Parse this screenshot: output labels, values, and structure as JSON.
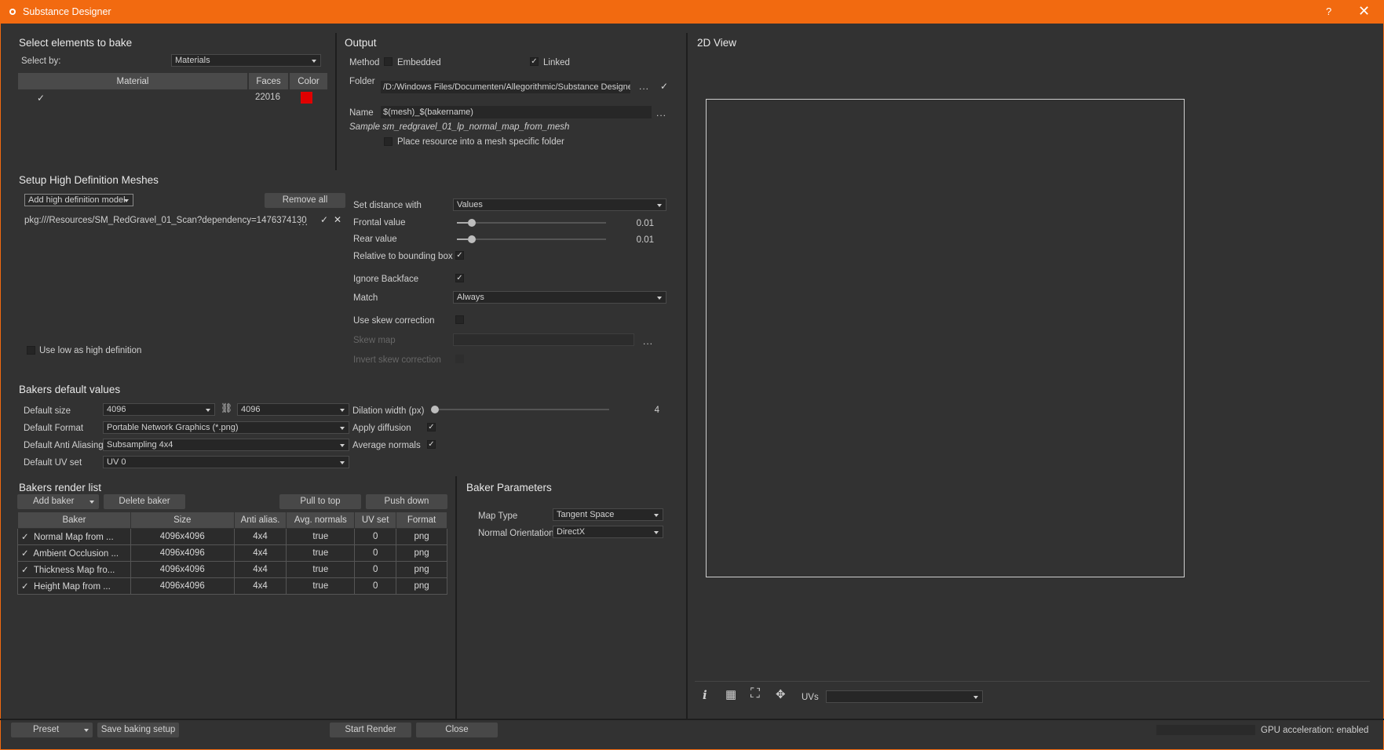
{
  "window": {
    "title": "Substance Designer",
    "help": "?",
    "close": "✕"
  },
  "select": {
    "heading": "Select elements to bake",
    "select_by_label": "Select by:",
    "select_by_value": "Materials",
    "columns": [
      "Material",
      "Faces",
      "Color"
    ],
    "rows": [
      {
        "checked": true,
        "material": "",
        "faces": "22016",
        "color": "#e00000"
      }
    ]
  },
  "output": {
    "heading": "Output",
    "method_label": "Method",
    "embedded_label": "Embedded",
    "embedded": false,
    "linked_label": "Linked",
    "linked": true,
    "folder_label": "Folder",
    "folder_value": "/D:/Windows Files/Documenten/Allegorithmic/Substance Designer",
    "folder_dots": "...",
    "name_label": "Name",
    "name_value": "$(mesh)_$(bakername)",
    "name_dots": "...",
    "sample_label": "Sample",
    "sample_value": "sm_redgravel_01_lp_normal_map_from_mesh",
    "specific_folder_label": "Place resource into a mesh specific folder",
    "specific_folder": false
  },
  "highdef": {
    "heading": "Setup High Definition Meshes",
    "add_label": "Add high definition model",
    "remove_all_label": "Remove all",
    "mesh_path": "pkg:///Resources/SM_RedGravel_01_Scan?dependency=1476374130",
    "mesh_dots": "...",
    "use_low_label": "Use low as high definition",
    "use_low": false
  },
  "distance": {
    "set_distance_label": "Set distance with",
    "set_distance_value": "Values",
    "frontal_label": "Frontal value",
    "frontal_value": "0.01",
    "frontal_level": 0.04,
    "rear_label": "Rear value",
    "rear_value": "0.01",
    "rear_level": 0.04,
    "relative_label": "Relative to bounding box",
    "relative": true,
    "ignore_backface_label": "Ignore Backface",
    "ignore_backface": true,
    "match_label": "Match",
    "match_value": "Always",
    "skew_correction_label": "Use skew correction",
    "skew_correction": false,
    "skew_map_label": "Skew map",
    "skew_map_dots": "...",
    "invert_skew_label": "Invert skew correction"
  },
  "defaults": {
    "heading": "Bakers default values",
    "size_label": "Default size",
    "size_w": "4096",
    "size_h": "4096",
    "format_label": "Default Format",
    "format_value": "Portable Network Graphics (*.png)",
    "aa_label": "Default Anti Aliasing",
    "aa_value": "Subsampling 4x4",
    "uv_label": "Default UV set",
    "uv_value": "UV 0",
    "dilation_label": "Dilation width (px)",
    "dilation_value": "4",
    "dilation_level": 0.0,
    "diffusion_label": "Apply diffusion",
    "diffusion": true,
    "avg_normals_label": "Average normals",
    "avg_normals": true
  },
  "render_list": {
    "heading": "Bakers render list",
    "add_baker_label": "Add baker",
    "delete_baker_label": "Delete baker",
    "pull_top_label": "Pull to top",
    "push_down_label": "Push down",
    "columns": [
      "Baker",
      "Size",
      "Anti alias.",
      "Avg. normals",
      "UV set",
      "Format"
    ],
    "rows": [
      {
        "checked": true,
        "baker": "Normal Map from ...",
        "size": "4096x4096",
        "aa": "4x4",
        "avg": "true",
        "uv": "0",
        "format": "png"
      },
      {
        "checked": true,
        "baker": "Ambient Occlusion ...",
        "size": "4096x4096",
        "aa": "4x4",
        "avg": "true",
        "uv": "0",
        "format": "png"
      },
      {
        "checked": true,
        "baker": "Thickness Map fro...",
        "size": "4096x4096",
        "aa": "4x4",
        "avg": "true",
        "uv": "0",
        "format": "png"
      },
      {
        "checked": true,
        "baker": "Height Map from ...",
        "size": "4096x4096",
        "aa": "4x4",
        "avg": "true",
        "uv": "0",
        "format": "png"
      }
    ]
  },
  "baker_params": {
    "heading": "Baker Parameters",
    "map_type_label": "Map Type",
    "map_type_value": "Tangent Space",
    "orientation_label": "Normal Orientation",
    "orientation_value": "DirectX"
  },
  "view2d": {
    "heading": "2D View",
    "uvs_label": "UVs",
    "uvs_value": "",
    "icons": [
      "info-icon",
      "grid-icon",
      "fit-view-icon",
      "pan-icon"
    ]
  },
  "footer": {
    "preset_label": "Preset",
    "save_label": "Save baking setup",
    "start_label": "Start Render",
    "close_label": "Close",
    "gpu_status": "GPU acceleration: enabled"
  }
}
